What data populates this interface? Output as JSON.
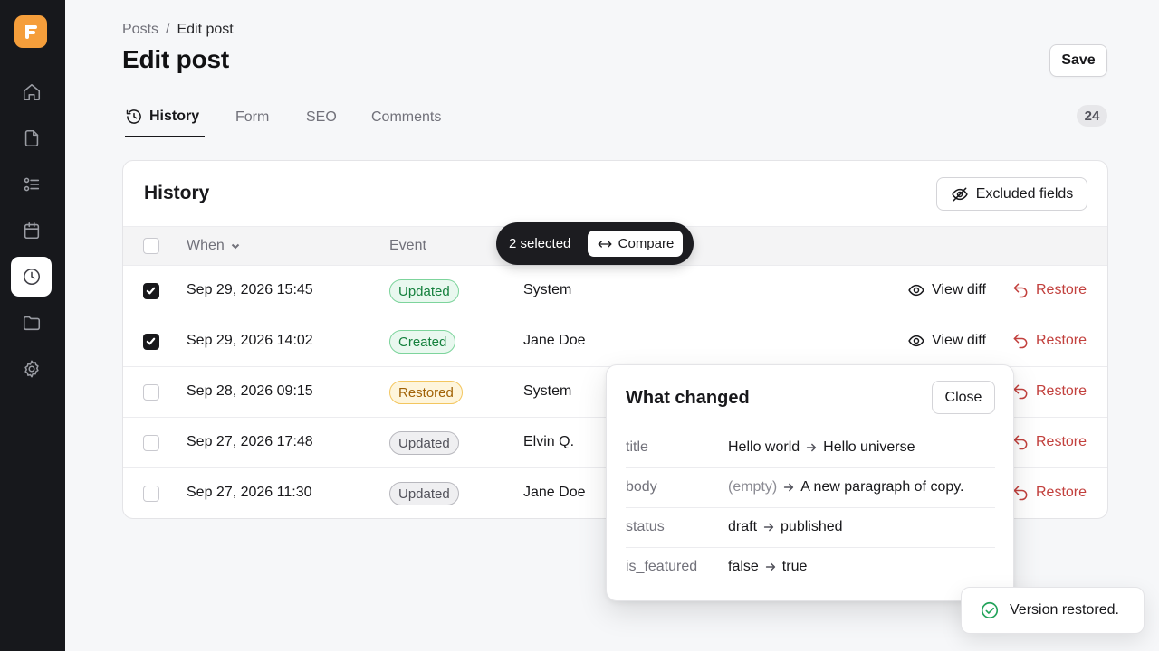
{
  "breadcrumb": {
    "parent": "Posts",
    "separator": "/",
    "current": "Edit post"
  },
  "page": {
    "title": "Edit post",
    "save_label": "Save"
  },
  "sidebar": {
    "logo": "brand-logo",
    "items": [
      {
        "name": "home",
        "icon": "home-icon",
        "active": false
      },
      {
        "name": "pages",
        "icon": "file-icon",
        "active": false
      },
      {
        "name": "lists",
        "icon": "list-icon",
        "active": false
      },
      {
        "name": "calendar",
        "icon": "calendar-icon",
        "active": false
      },
      {
        "name": "history",
        "icon": "clock-icon",
        "active": true
      },
      {
        "name": "folders",
        "icon": "folder-icon",
        "active": false
      },
      {
        "name": "settings",
        "icon": "gear-icon",
        "active": false
      }
    ]
  },
  "tabs": {
    "items": [
      {
        "label": "History",
        "active": true,
        "icon": "history-icon"
      },
      {
        "label": "Form",
        "active": false
      },
      {
        "label": "SEO",
        "active": false
      },
      {
        "label": "Comments",
        "active": false
      }
    ],
    "count": "24"
  },
  "history": {
    "title": "History",
    "excluded_label": "Excluded fields",
    "columns": {
      "when": "When",
      "event": "Event"
    },
    "rows": [
      {
        "checked": true,
        "when": "Sep 29, 2026 15:45",
        "event": "Updated",
        "event_style": "updated",
        "actor": "System",
        "view_diff": "View diff",
        "restore": "Restore"
      },
      {
        "checked": true,
        "when": "Sep 29, 2026 14:02",
        "event": "Created",
        "event_style": "created",
        "actor": "Jane Doe",
        "view_diff": "View diff",
        "restore": "Restore"
      },
      {
        "checked": false,
        "when": "Sep 28, 2026 09:15",
        "event": "Restored",
        "event_style": "restored",
        "actor": "System",
        "restore": "Restore"
      },
      {
        "checked": false,
        "when": "Sep 27, 2026 17:48",
        "event": "Updated",
        "event_style": "muted",
        "actor": "Elvin Q.",
        "restore": "Restore"
      },
      {
        "checked": false,
        "when": "Sep 27, 2026 11:30",
        "event": "Updated",
        "event_style": "muted",
        "actor": "Jane Doe",
        "restore": "Restore"
      }
    ]
  },
  "selection": {
    "count_label": "2 selected",
    "compare_label": "Compare"
  },
  "diff_popover": {
    "title": "What changed",
    "close_label": "Close",
    "changes": [
      {
        "field": "title",
        "old": "Hello world",
        "new": "Hello universe"
      },
      {
        "field": "body",
        "old": "(empty)",
        "new": "A new paragraph of copy."
      },
      {
        "field": "status",
        "old": "draft",
        "new": "published"
      },
      {
        "field": "is_featured",
        "old": "false",
        "new": "true"
      }
    ]
  },
  "toast": {
    "message": "Version restored."
  },
  "colors": {
    "accent": "#f59e3b",
    "sidebar": "#17181c",
    "restore": "#c2403d",
    "success": "#22a35a"
  }
}
